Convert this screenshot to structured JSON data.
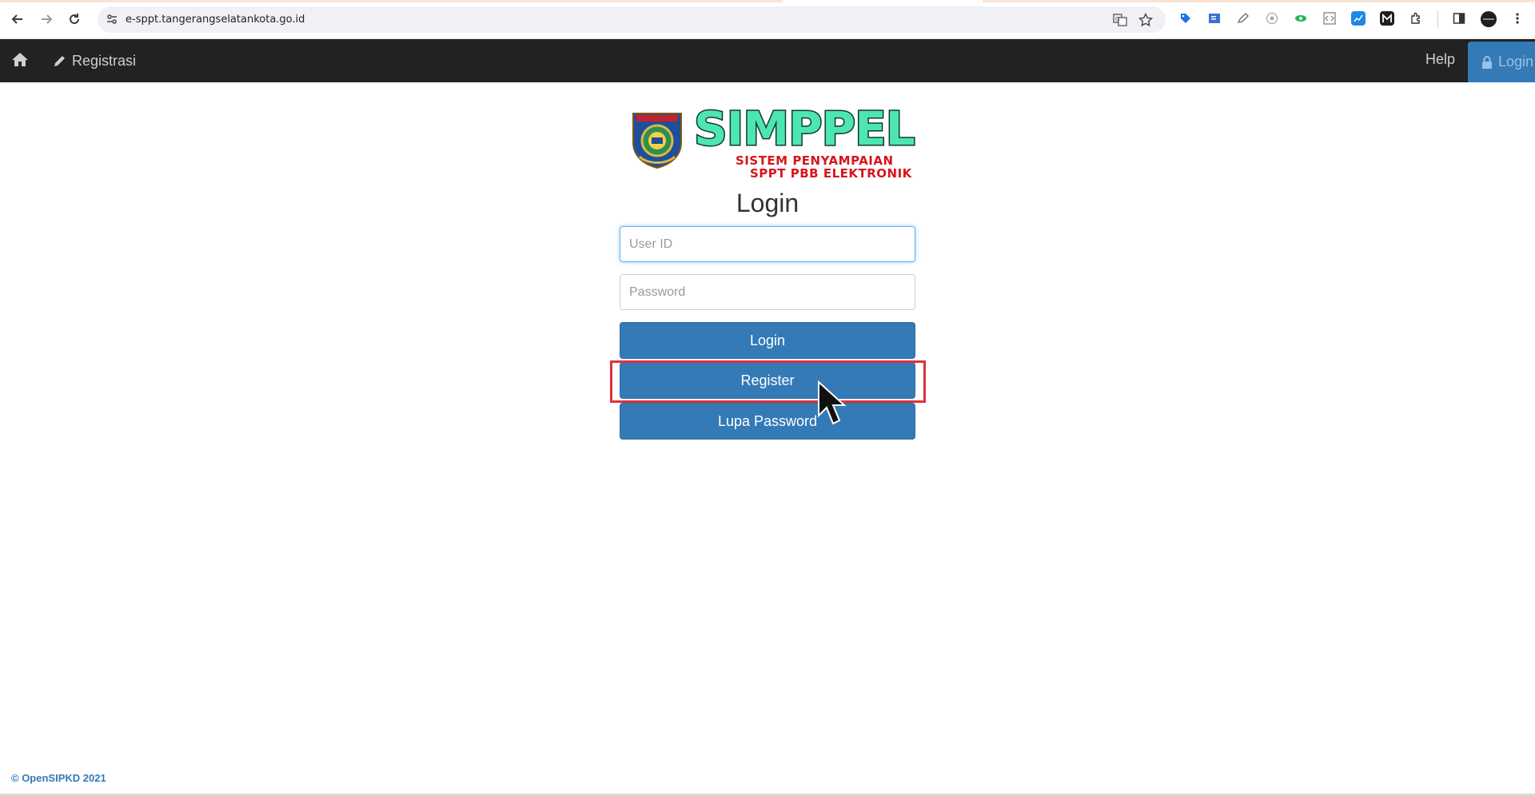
{
  "browser": {
    "url": "e-sppt.tangerangselatankota.go.id",
    "extensions": [
      "translate-icon",
      "star-icon",
      "tag-ext-icon",
      "reader-ext-icon",
      "pen-ext-icon",
      "chrome-ext-icon",
      "eye-ext-icon",
      "code-ext-icon",
      "chart-ext-icon",
      "m-ext-icon",
      "puzzle-icon",
      "sidepanel-icon"
    ]
  },
  "navbar": {
    "registrasi_label": "Registrasi",
    "help_label": "Help",
    "login_label": "Login"
  },
  "logo": {
    "brand": "SIMPPEL",
    "sub1": "SISTEM PENYAMPAIAN",
    "sub2": "SPPT PBB ELEKTRONIK"
  },
  "form": {
    "title": "Login",
    "userid_placeholder": "User ID",
    "password_placeholder": "Password",
    "login_button": "Login",
    "register_button": "Register",
    "forgot_button": "Lupa Password"
  },
  "footer": {
    "text": "© OpenSIPKD 2021"
  },
  "colors": {
    "primary": "#337ab7",
    "navbar": "#222222",
    "highlight": "#e0303a",
    "brand_green": "#4ee6b0",
    "brand_red": "#d8141c"
  }
}
